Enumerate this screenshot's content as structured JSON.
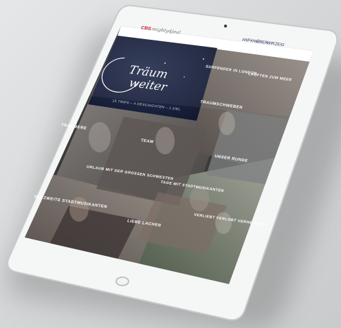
{
  "header": {
    "logo": "CBS",
    "brand": "mighty4jeal",
    "nav": [
      "ANFANG",
      "ÜBER",
      "WIR",
      "ZEIG"
    ]
  },
  "hero": {
    "title_line1": "Träum",
    "title_line2": "weiter",
    "subtitle": "15 TRIPS – 4 GESCHICHTEN – 1 ZIEL"
  },
  "tiles": [
    {
      "label": "SURFENDER IN LONDON",
      "color": "#6e6a68"
    },
    {
      "label": "LAUFTEN ZUM MEER",
      "color": "#857a70"
    },
    {
      "label": "TRAUMSCHWEBEN",
      "color": "#7b7f81"
    },
    {
      "label": "TRAUMERE",
      "color": "#6d6f70"
    },
    {
      "label": "TEAM",
      "color": "#4f4d4c"
    },
    {
      "label": "UNSER RUNDE",
      "color": "#5a5c5d"
    },
    {
      "label": "URLAUB MIT DER GROSSEN SCHWESTER",
      "color": "#504a48"
    },
    {
      "label": "TAGE MIT STADTMUSIKANTEN",
      "color": "#7a6a62"
    },
    {
      "label": "DIE ZWEITE STADTMUSIKANTEN",
      "color": "#5e5450"
    },
    {
      "label": "LIEBE LACHEN",
      "color": "#6a6560"
    },
    {
      "label": "VERLIEBT VERLOBT VERHEIRATET",
      "color": "#6a7667"
    }
  ],
  "icons": [
    "camera-icon",
    "home-button-icon"
  ]
}
